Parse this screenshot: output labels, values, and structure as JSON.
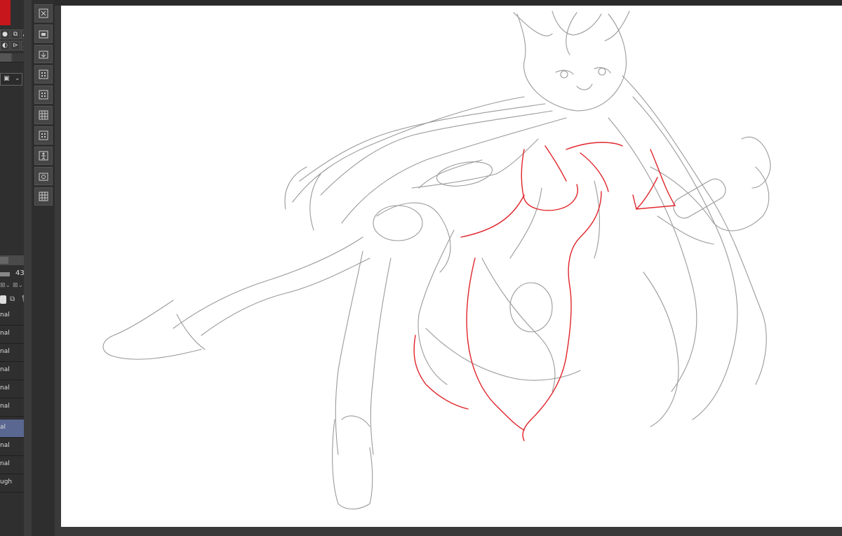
{
  "app": {
    "accent_color": "#c8161d",
    "selection_color": "#5a6790"
  },
  "left_panel": {
    "opacity_value": "43",
    "layers": [
      {
        "blend": "nal",
        "active": false
      },
      {
        "blend": "nal",
        "active": false
      },
      {
        "blend": "nal",
        "active": false
      },
      {
        "blend": "nal",
        "active": false
      },
      {
        "blend": "nal",
        "active": false
      },
      {
        "blend": "nal",
        "active": false
      },
      {
        "blend": "al",
        "active": true
      },
      {
        "blend": "nal",
        "active": false
      },
      {
        "blend": "nal",
        "active": false
      },
      {
        "blend": "ugh",
        "active": false
      }
    ]
  },
  "toolbar": {
    "buttons": [
      "close-layer-icon",
      "folder-icon",
      "import-icon",
      "grid-icon",
      "grid-icon",
      "grid-icon",
      "grid-icon",
      "figure-icon",
      "camera-icon",
      "grid-icon"
    ]
  },
  "canvas": {
    "sketch_colors": {
      "pencil": "#8a8a8a",
      "red_line": "#e0242a"
    }
  }
}
